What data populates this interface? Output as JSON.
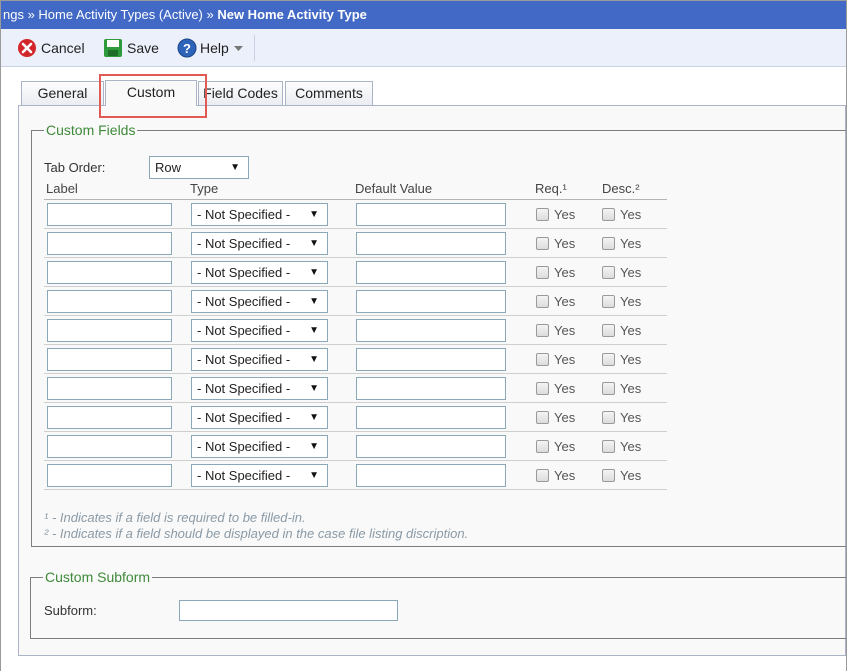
{
  "breadcrumb": {
    "part1": "ngs » Home Activity Types (Active) » ",
    "current": "New Home Activity Type"
  },
  "toolbar": {
    "cancel_label": "Cancel",
    "save_label": "Save",
    "help_label": "Help"
  },
  "tabs": [
    {
      "label": "General"
    },
    {
      "label": "Custom"
    },
    {
      "label": "Field Codes"
    },
    {
      "label": "Comments"
    }
  ],
  "custom_fields": {
    "legend": "Custom Fields",
    "tab_order_label": "Tab Order:",
    "tab_order_value": "Row",
    "columns": {
      "label": "Label",
      "type": "Type",
      "default_value": "Default Value",
      "req": "Req.¹",
      "desc": "Desc.²"
    },
    "rows": [
      {
        "label": "",
        "type": "- Not Specified -",
        "default": "",
        "req": "Yes",
        "desc": "Yes"
      },
      {
        "label": "",
        "type": "- Not Specified -",
        "default": "",
        "req": "Yes",
        "desc": "Yes"
      },
      {
        "label": "",
        "type": "- Not Specified -",
        "default": "",
        "req": "Yes",
        "desc": "Yes"
      },
      {
        "label": "",
        "type": "- Not Specified -",
        "default": "",
        "req": "Yes",
        "desc": "Yes"
      },
      {
        "label": "",
        "type": "- Not Specified -",
        "default": "",
        "req": "Yes",
        "desc": "Yes"
      },
      {
        "label": "",
        "type": "- Not Specified -",
        "default": "",
        "req": "Yes",
        "desc": "Yes"
      },
      {
        "label": "",
        "type": "- Not Specified -",
        "default": "",
        "req": "Yes",
        "desc": "Yes"
      },
      {
        "label": "",
        "type": "- Not Specified -",
        "default": "",
        "req": "Yes",
        "desc": "Yes"
      },
      {
        "label": "",
        "type": "- Not Specified -",
        "default": "",
        "req": "Yes",
        "desc": "Yes"
      },
      {
        "label": "",
        "type": "- Not Specified -",
        "default": "",
        "req": "Yes",
        "desc": "Yes"
      }
    ],
    "note1": "¹ - Indicates if a field is required to be filled-in.",
    "note2": "² - Indicates if a field should be displayed in the case file listing discription."
  },
  "custom_subform": {
    "legend": "Custom Subform",
    "subform_label": "Subform:",
    "subform_value": ""
  },
  "colors": {
    "titlebar": "#4169c5",
    "legend_green": "#3f8a3a",
    "highlight_red": "#e05b53"
  }
}
